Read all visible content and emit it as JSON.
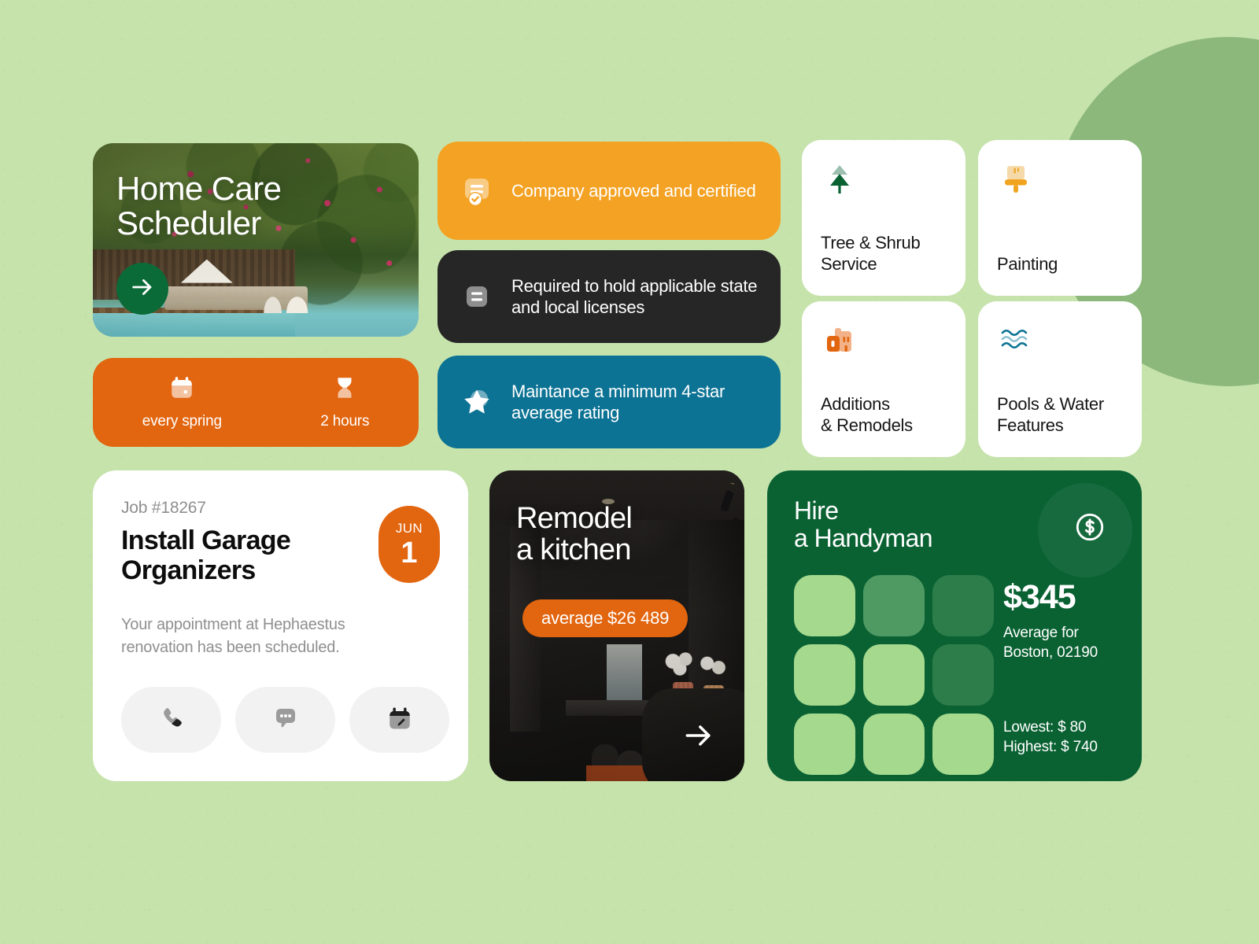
{
  "theme": {
    "bg": "#c6e3ac",
    "deco_circle": "#8cb87c",
    "orange": "#e2650f",
    "amber": "#f4a223",
    "ink": "#262626",
    "teal": "#0d7394",
    "green_dark": "#0a6233",
    "green_cta": "#0a6b38"
  },
  "hero": {
    "title": "Home Care\nScheduler",
    "cta_icon": "arrow-right-icon"
  },
  "meta_bar": {
    "items": [
      {
        "icon": "calendar-icon",
        "label": "every spring"
      },
      {
        "icon": "hourglass-icon",
        "label": "2 hours"
      }
    ]
  },
  "info_cards": [
    {
      "icon": "certified-document-icon",
      "text": "Company approved and certified",
      "color": "#f4a223"
    },
    {
      "icon": "license-document-icon",
      "text": "Required to hold applicable state and local licenses",
      "color": "#262626"
    },
    {
      "icon": "star-rating-icon",
      "text": "Maintance a minimum 4-star average rating",
      "color": "#0d7394"
    }
  ],
  "service_tiles": [
    {
      "icon": "tree-icon",
      "label": "Tree & Shrub\nService"
    },
    {
      "icon": "paint-brush-icon",
      "label": "Painting"
    },
    {
      "icon": "building-icon",
      "label": "Additions\n& Remodels"
    },
    {
      "icon": "waves-icon",
      "label": "Pools & Water\nFeatures"
    }
  ],
  "job_card": {
    "job_id": "Job #18267",
    "title": "Install Garage\nOrganizers",
    "description": "Your appointment at Hephaestus renovation has been scheduled.",
    "date": {
      "month": "JUN",
      "day": "1"
    },
    "actions": [
      {
        "icon": "phone-icon",
        "name": "call-button"
      },
      {
        "icon": "message-icon",
        "name": "message-button"
      },
      {
        "icon": "calendar-edit-icon",
        "name": "reschedule-button"
      }
    ]
  },
  "kitchen_card": {
    "title": "Remodel\na kitchen",
    "price_pill": "average $26 489",
    "arrow_icon": "arrow-right-icon"
  },
  "handyman_card": {
    "title": "Hire\na Handyman",
    "badge_icon": "dollar-circle-icon",
    "price": "$345",
    "subtitle": "Average for\nBoston, 02190",
    "range": "Lowest: $ 80\nHighest: $ 740",
    "grid_cells": [
      "#a5d98e",
      "#4f9a63",
      "#2d7d4a",
      "#a5d98e",
      "#a5d98e",
      "#2d7d4a",
      "#a5d98e",
      "#a5d98e",
      "#a5d98e"
    ]
  }
}
